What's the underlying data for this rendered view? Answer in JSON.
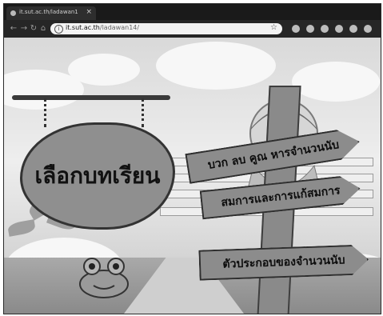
{
  "browser": {
    "tab": {
      "title": "it.sut.ac.th/ladawan1",
      "close": "×"
    },
    "nav": {
      "back": "←",
      "forward": "→",
      "reload": "↻",
      "home": "⌂"
    },
    "address": {
      "host": "it.sut.ac.th",
      "path": "/ladawan14/"
    },
    "star": "☆"
  },
  "page": {
    "board_title": "เลือกบทเรียน",
    "menu": [
      {
        "label": "บวก ลบ คูณ หารจำนวนนับ"
      },
      {
        "label": "สมการและการแก้สมการ"
      },
      {
        "label": "ตัวประกอบของจำนวนนับ"
      }
    ]
  },
  "icons": {
    "info": "info-icon",
    "star": "star-icon",
    "extensions": [
      "extension-icon",
      "extension-icon",
      "extension-icon",
      "extension-icon",
      "extension-icon"
    ]
  }
}
